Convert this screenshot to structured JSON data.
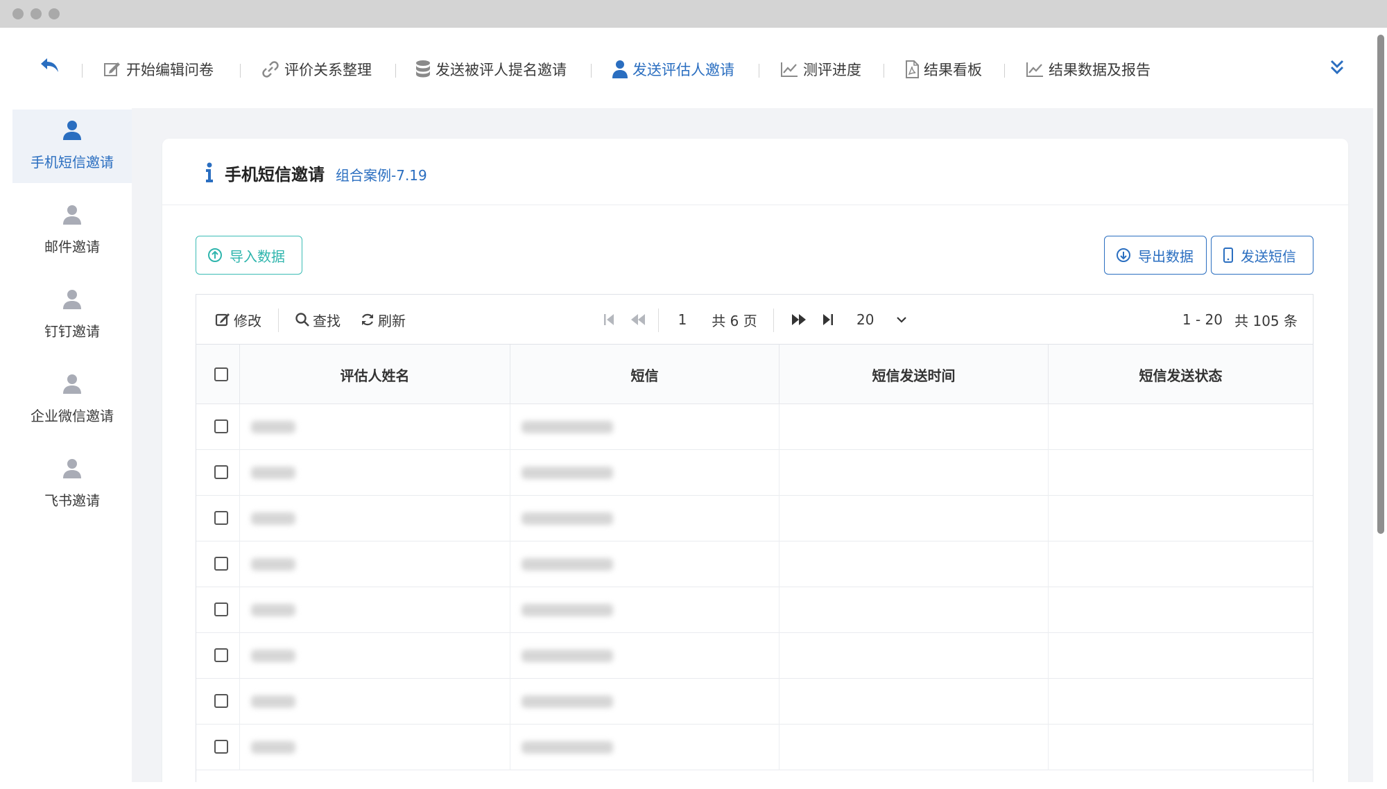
{
  "nav": {
    "items": [
      {
        "label": "开始编辑问卷",
        "icon": "edit-icon"
      },
      {
        "label": "评价关系整理",
        "icon": "link-icon"
      },
      {
        "label": "发送被评人提名邀请",
        "icon": "database-icon"
      },
      {
        "label": "发送评估人邀请",
        "icon": "user-icon",
        "active": true
      },
      {
        "label": "测评进度",
        "icon": "line-chart-icon"
      },
      {
        "label": "结果看板",
        "icon": "pdf-file-icon"
      },
      {
        "label": "结果数据及报告",
        "icon": "line-chart-icon"
      }
    ]
  },
  "sidebar": {
    "items": [
      {
        "label": "手机短信邀请",
        "active": true
      },
      {
        "label": "邮件邀请"
      },
      {
        "label": "钉钉邀请"
      },
      {
        "label": "企业微信邀请"
      },
      {
        "label": "飞书邀请"
      }
    ]
  },
  "card": {
    "title": "手机短信邀请",
    "subtitle": "组合案例-7.19"
  },
  "buttons": {
    "import": "导入数据",
    "export": "导出数据",
    "send_sms": "发送短信"
  },
  "toolbar": {
    "edit": "修改",
    "search": "查找",
    "refresh": "刷新",
    "current_page": "1",
    "total_pages": "共 6 页",
    "page_size": "20",
    "range": "1 - 20",
    "total": "共 105 条"
  },
  "table": {
    "columns": [
      "评估人姓名",
      "短信",
      "短信发送时间",
      "短信发送状态"
    ],
    "row_count_visible": 8
  },
  "colors": {
    "accent": "#2a6ec0",
    "teal": "#2fb5ad",
    "background": "#f2f3f6"
  }
}
